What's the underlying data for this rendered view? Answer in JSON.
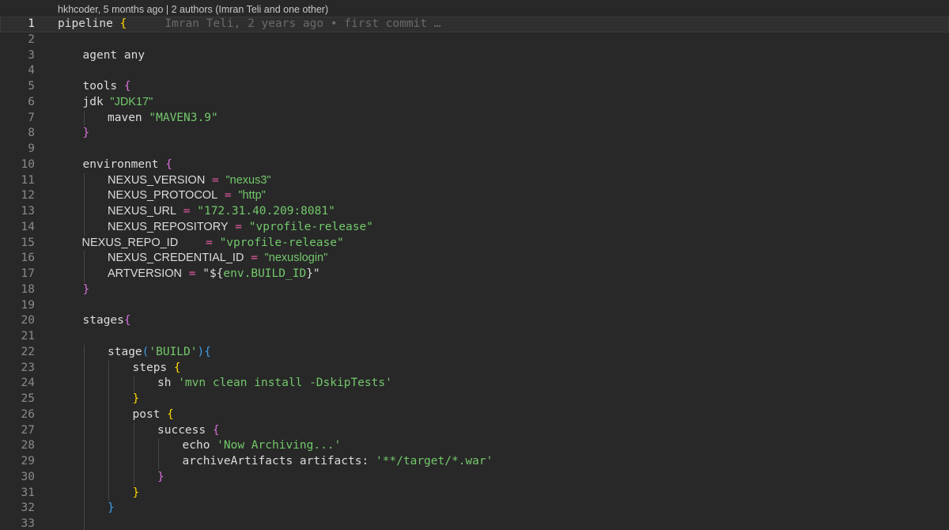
{
  "codelens": "hkhcoder, 5 months ago | 2 authors (Imran Teli and one other)",
  "blame": "Imran Teli, 2 years ago • first commit …",
  "lines": [
    {
      "n": "1",
      "indent": 0,
      "guides": [],
      "tokens": [
        {
          "t": "pipeline ",
          "c": "plain"
        },
        {
          "t": "{",
          "c": "brace-y"
        }
      ],
      "current": true
    },
    {
      "n": "2",
      "indent": 0,
      "guides": [],
      "tokens": []
    },
    {
      "n": "3",
      "indent": 1,
      "guides": [],
      "tokens": [
        {
          "t": "agent any",
          "c": "plain"
        }
      ]
    },
    {
      "n": "4",
      "indent": 0,
      "guides": [],
      "tokens": []
    },
    {
      "n": "5",
      "indent": 1,
      "guides": [],
      "tokens": [
        {
          "t": "tools ",
          "c": "plain"
        },
        {
          "t": "{",
          "c": "brace-m"
        }
      ]
    },
    {
      "n": "6",
      "indent": 1,
      "guides": [],
      "tokens": [
        {
          "t": "jdk ",
          "c": "plain"
        },
        {
          "t": "\"JDK17\"",
          "c": "str prop"
        }
      ]
    },
    {
      "n": "7",
      "indent": 2,
      "guides": [
        1
      ],
      "tokens": [
        {
          "t": "maven ",
          "c": "plain"
        },
        {
          "t": "\"MAVEN3.9\"",
          "c": "str"
        }
      ]
    },
    {
      "n": "8",
      "indent": 1,
      "guides": [],
      "tokens": [
        {
          "t": "}",
          "c": "brace-m"
        }
      ]
    },
    {
      "n": "9",
      "indent": 0,
      "guides": [],
      "tokens": []
    },
    {
      "n": "10",
      "indent": 1,
      "guides": [],
      "tokens": [
        {
          "t": "environment ",
          "c": "plain"
        },
        {
          "t": "{",
          "c": "brace-m"
        }
      ]
    },
    {
      "n": "11",
      "indent": 2,
      "guides": [
        1
      ],
      "tokens": [
        {
          "t": "NEXUS_VERSION",
          "c": "plain prop"
        },
        {
          "t": " = ",
          "c": "op"
        },
        {
          "t": "\"nexus3\"",
          "c": "str prop"
        }
      ]
    },
    {
      "n": "12",
      "indent": 2,
      "guides": [
        1
      ],
      "tokens": [
        {
          "t": "NEXUS_PROTOCOL",
          "c": "plain prop"
        },
        {
          "t": " = ",
          "c": "op"
        },
        {
          "t": "\"http\"",
          "c": "str prop"
        }
      ]
    },
    {
      "n": "13",
      "indent": 2,
      "guides": [
        1
      ],
      "tokens": [
        {
          "t": "NEXUS_URL",
          "c": "plain prop"
        },
        {
          "t": " = ",
          "c": "op"
        },
        {
          "t": "\"172.31.40.209:8081\"",
          "c": "str"
        }
      ]
    },
    {
      "n": "14",
      "indent": 2,
      "guides": [
        1
      ],
      "tokens": [
        {
          "t": "NEXUS_REPOSITORY",
          "c": "plain prop"
        },
        {
          "t": " = ",
          "c": "op"
        },
        {
          "t": "\"vprofile-release\"",
          "c": "str"
        }
      ]
    },
    {
      "n": "15",
      "indent": 1,
      "guides": [],
      "tokens": [
        {
          "t": "NEXUS_REPO_ID",
          "c": "plain prop"
        },
        {
          "t": "    = ",
          "c": "op"
        },
        {
          "t": "\"vprofile-release\"",
          "c": "str"
        }
      ],
      "shift": -1
    },
    {
      "n": "16",
      "indent": 2,
      "guides": [
        1
      ],
      "tokens": [
        {
          "t": "NEXUS_CREDENTIAL_ID",
          "c": "plain prop"
        },
        {
          "t": " = ",
          "c": "op"
        },
        {
          "t": "\"nexuslogin\"",
          "c": "str prop"
        }
      ]
    },
    {
      "n": "17",
      "indent": 2,
      "guides": [
        1
      ],
      "tokens": [
        {
          "t": "ARTVERSION",
          "c": "plain prop"
        },
        {
          "t": " = ",
          "c": "op"
        },
        {
          "t": "\"${",
          "c": "plain"
        },
        {
          "t": "env.BUILD_ID",
          "c": "str"
        },
        {
          "t": "}\"",
          "c": "plain"
        }
      ]
    },
    {
      "n": "18",
      "indent": 1,
      "guides": [],
      "tokens": [
        {
          "t": "}",
          "c": "brace-m"
        }
      ]
    },
    {
      "n": "19",
      "indent": 0,
      "guides": [],
      "tokens": []
    },
    {
      "n": "20",
      "indent": 1,
      "guides": [],
      "tokens": [
        {
          "t": "stages",
          "c": "plain"
        },
        {
          "t": "{",
          "c": "brace-m"
        }
      ]
    },
    {
      "n": "21",
      "indent": 0,
      "guides": [],
      "tokens": []
    },
    {
      "n": "22",
      "indent": 2,
      "guides": [
        1
      ],
      "tokens": [
        {
          "t": "stage",
          "c": "plain"
        },
        {
          "t": "(",
          "c": "brace-b"
        },
        {
          "t": "'BUILD'",
          "c": "str"
        },
        {
          "t": ")",
          "c": "brace-b"
        },
        {
          "t": "{",
          "c": "brace-b"
        }
      ]
    },
    {
      "n": "23",
      "indent": 3,
      "guides": [
        1,
        2
      ],
      "tokens": [
        {
          "t": "steps ",
          "c": "plain"
        },
        {
          "t": "{",
          "c": "brace-y"
        }
      ]
    },
    {
      "n": "24",
      "indent": 4,
      "guides": [
        1,
        2,
        3
      ],
      "tokens": [
        {
          "t": "sh ",
          "c": "plain"
        },
        {
          "t": "'mvn clean install -DskipTests'",
          "c": "str"
        }
      ]
    },
    {
      "n": "25",
      "indent": 3,
      "guides": [
        1,
        2
      ],
      "tokens": [
        {
          "t": "}",
          "c": "brace-y"
        }
      ]
    },
    {
      "n": "26",
      "indent": 3,
      "guides": [
        1,
        2
      ],
      "tokens": [
        {
          "t": "post ",
          "c": "plain"
        },
        {
          "t": "{",
          "c": "brace-y"
        }
      ]
    },
    {
      "n": "27",
      "indent": 4,
      "guides": [
        1,
        2,
        3
      ],
      "tokens": [
        {
          "t": "success ",
          "c": "plain"
        },
        {
          "t": "{",
          "c": "brace-m"
        }
      ]
    },
    {
      "n": "28",
      "indent": 5,
      "guides": [
        1,
        2,
        3,
        4
      ],
      "tokens": [
        {
          "t": "echo ",
          "c": "plain"
        },
        {
          "t": "'Now Archiving...'",
          "c": "str"
        }
      ]
    },
    {
      "n": "29",
      "indent": 5,
      "guides": [
        1,
        2,
        3,
        4
      ],
      "tokens": [
        {
          "t": "archiveArtifacts artifacts: ",
          "c": "plain"
        },
        {
          "t": "'**/target/*.war'",
          "c": "str"
        }
      ]
    },
    {
      "n": "30",
      "indent": 4,
      "guides": [
        1,
        2,
        3
      ],
      "tokens": [
        {
          "t": "}",
          "c": "brace-m"
        }
      ]
    },
    {
      "n": "31",
      "indent": 3,
      "guides": [
        1,
        2
      ],
      "tokens": [
        {
          "t": "}",
          "c": "brace-y"
        }
      ]
    },
    {
      "n": "32",
      "indent": 2,
      "guides": [
        1
      ],
      "tokens": [
        {
          "t": "}",
          "c": "brace-b"
        }
      ]
    },
    {
      "n": "33",
      "indent": 0,
      "guides": [
        1
      ],
      "tokens": []
    }
  ]
}
